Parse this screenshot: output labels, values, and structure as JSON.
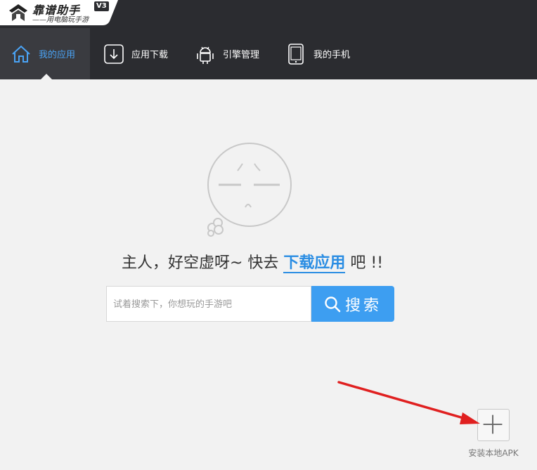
{
  "app": {
    "title": "靠谱助手",
    "subtitle": "——用电脑玩手游",
    "version_badge": "V3"
  },
  "nav": {
    "items": [
      {
        "label": "我的应用",
        "icon": "home-icon",
        "active": true
      },
      {
        "label": "应用下载",
        "icon": "download-icon",
        "active": false
      },
      {
        "label": "引擎管理",
        "icon": "android-icon",
        "active": false
      },
      {
        "label": "我的手机",
        "icon": "phone-icon",
        "active": false
      }
    ]
  },
  "empty_state": {
    "headline_prefix": "主人，好空虚呀~ 快去",
    "headline_link": "下载应用",
    "headline_suffix": "吧 !!",
    "face_icon": "sleepy-face-icon"
  },
  "search": {
    "placeholder": "试着搜索下，你想玩的手游吧",
    "value": "",
    "button_label": "搜索",
    "button_icon": "search-icon"
  },
  "install_apk": {
    "label": "安装本地APK",
    "icon": "plus-icon"
  },
  "annotation": {
    "arrow_color": "#e02020"
  },
  "colors": {
    "nav_background": "#2b2c30",
    "accent_blue": "#3d9ef1",
    "link_blue": "#2a8de3",
    "page_background": "#f2f2f2"
  }
}
